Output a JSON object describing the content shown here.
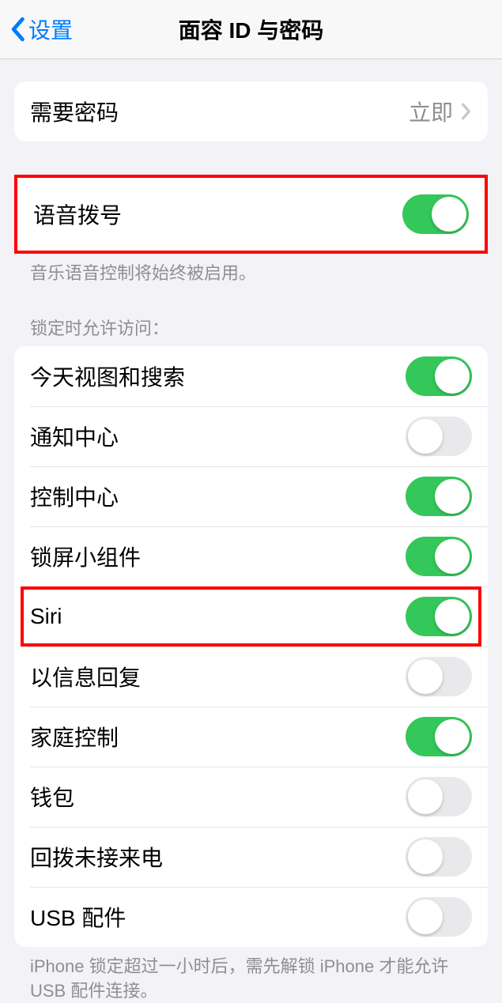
{
  "nav": {
    "back_label": "设置",
    "title": "面容 ID 与密码"
  },
  "passcode_group": {
    "require_label": "需要密码",
    "require_value": "立即"
  },
  "voice_dial": {
    "label": "语音拨号",
    "enabled": true,
    "footer": "音乐语音控制将始终被启用。"
  },
  "locked_access": {
    "header": "锁定时允许访问：",
    "items": [
      {
        "label": "今天视图和搜索",
        "enabled": true
      },
      {
        "label": "通知中心",
        "enabled": false
      },
      {
        "label": "控制中心",
        "enabled": true
      },
      {
        "label": "锁屏小组件",
        "enabled": true
      },
      {
        "label": "Siri",
        "enabled": true,
        "highlighted": true
      },
      {
        "label": "以信息回复",
        "enabled": false
      },
      {
        "label": "家庭控制",
        "enabled": true
      },
      {
        "label": "钱包",
        "enabled": false
      },
      {
        "label": "回拨未接来电",
        "enabled": false
      },
      {
        "label": "USB 配件",
        "enabled": false
      }
    ],
    "footer": "iPhone 锁定超过一小时后，需先解锁 iPhone 才能允许 USB 配件连接。"
  }
}
